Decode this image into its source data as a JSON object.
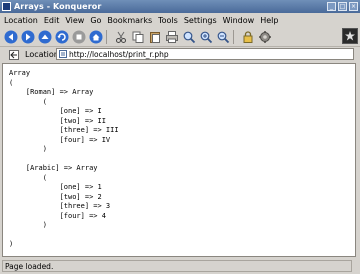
{
  "window": {
    "title": "Arrays - Konqueror"
  },
  "menubar": {
    "items": [
      "Location",
      "Edit",
      "View",
      "Go",
      "Bookmarks",
      "Tools",
      "Settings",
      "Window",
      "Help"
    ]
  },
  "toolbar": {
    "icons": [
      "back-icon",
      "forward-icon",
      "up-icon",
      "reload-icon",
      "stop-icon",
      "home-icon",
      "cut-icon",
      "copy-icon",
      "paste-icon",
      "print-icon",
      "find-icon",
      "zoom-in-icon",
      "zoom-out-icon",
      "security-lock-icon",
      "settings-icon"
    ]
  },
  "location": {
    "label": "Location:",
    "url": "http://localhost/print_r.php"
  },
  "content": {
    "text": "Array\n(\n    [Roman] => Array\n        (\n            [one] => I\n            [two] => II\n            [three] => III\n            [four] => IV\n        )\n\n    [Arabic] => Array\n        (\n            [one] => 1\n            [two] => 2\n            [three] => 3\n            [four] => 4\n        )\n\n)"
  },
  "status": {
    "text": "Page loaded."
  },
  "colors": {
    "titlebar": "#4a6a99",
    "chrome": "#d6d3ce",
    "page": "#ffffff"
  }
}
